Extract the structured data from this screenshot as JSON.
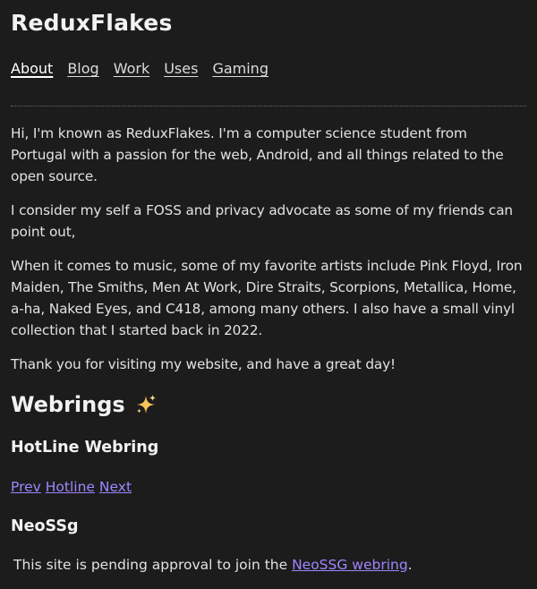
{
  "site": {
    "title": "ReduxFlakes"
  },
  "nav": {
    "items": [
      "About",
      "Blog",
      "Work",
      "Uses",
      "Gaming"
    ],
    "active": "About"
  },
  "intro": {
    "paragraphs": [
      "Hi, I'm known as ReduxFlakes. I'm a computer science student from Portugal with a passion for the web, Android, and all things related to the open source.",
      "I consider my self a FOSS and privacy advocate as some of my friends can point out,",
      "When it comes to music, some of my favorite artists include Pink Floyd, Iron Maiden, The Smiths, Men At Work, Dire Straits, Scorpions, Metallica, Home, a-ha, Naked Eyes, and C418, among many others. I also have a small vinyl collection that I started back in 2022.",
      "Thank you for visiting my website, and have a great day!"
    ]
  },
  "webrings": {
    "heading": "Webrings",
    "heading_icon": "sparkles-icon",
    "hotline": {
      "heading": "HotLine Webring",
      "prev": "Prev",
      "hub": "Hotline",
      "next": "Next"
    },
    "neossg": {
      "heading": "NeoSSg",
      "text_before": "This site is pending approval to join the ",
      "link": "NeoSSG webring",
      "text_after": "."
    }
  },
  "colors": {
    "background": "#1c1c1c",
    "text": "#e2e2e2",
    "link": "#9f86ff",
    "sparkle": "#f6c35a"
  }
}
